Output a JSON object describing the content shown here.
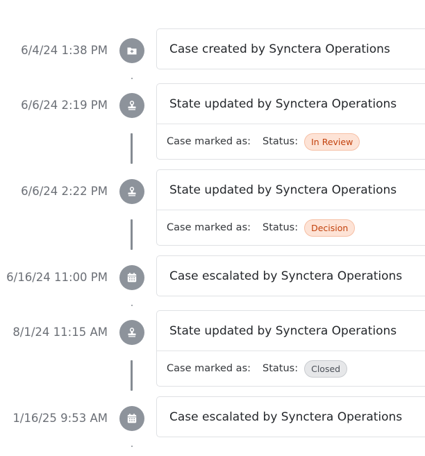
{
  "timeline": {
    "marked_as_label": "Case marked as:",
    "status_label": "Status:",
    "events": [
      {
        "timestamp": "6/4/24 1:38 PM",
        "icon": "folder-plus-icon",
        "title": "Case created by Synctera Operations"
      },
      {
        "timestamp": "6/6/24 2:19 PM",
        "icon": "stamp-icon",
        "title": "State updated by Synctera Operations",
        "status": "In Review",
        "status_color": "#c2410c",
        "status_bg": "#fde3d6",
        "status_border": "#f6bfa5"
      },
      {
        "timestamp": "6/6/24 2:22 PM",
        "icon": "stamp-icon",
        "title": "State updated by Synctera Operations",
        "status": "Decision",
        "status_color": "#c2410c",
        "status_bg": "#fde3d6",
        "status_border": "#f6bfa5"
      },
      {
        "timestamp": "6/16/24 11:00 PM",
        "icon": "calendar-icon",
        "title": "Case escalated by Synctera Operations"
      },
      {
        "timestamp": "8/1/24 11:15 AM",
        "icon": "stamp-icon",
        "title": "State updated by Synctera Operations",
        "status": "Closed",
        "status_color": "#4b5058",
        "status_bg": "#e6e7e9",
        "status_border": "#c9ccd0"
      },
      {
        "timestamp": "1/16/25 9:53 AM",
        "icon": "calendar-icon",
        "title": "Case escalated by Synctera Operations"
      }
    ]
  }
}
